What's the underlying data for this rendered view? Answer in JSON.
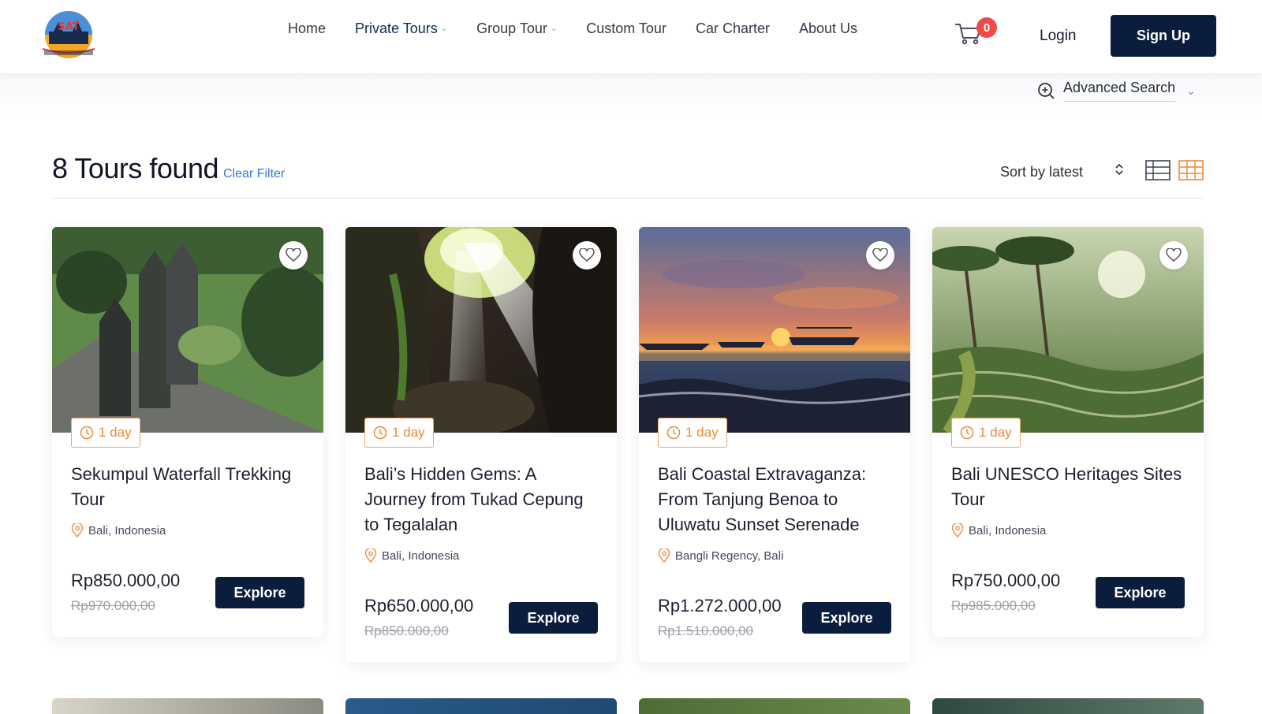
{
  "brand": {
    "logo_name": "site-logo"
  },
  "nav": {
    "items": [
      {
        "label": "Home",
        "dropdown": false
      },
      {
        "label": "Private Tours",
        "dropdown": true,
        "active": true
      },
      {
        "label": "Group Tour",
        "dropdown": true
      },
      {
        "label": "Custom Tour",
        "dropdown": false
      },
      {
        "label": "Car Charter",
        "dropdown": false
      },
      {
        "label": "About Us",
        "dropdown": false
      }
    ],
    "cart_count": "0",
    "login_label": "Login",
    "signup_label": "Sign Up"
  },
  "search": {
    "advanced_label": "Advanced Search"
  },
  "results": {
    "count_label": "8 Tours found",
    "clear_filter_label": "Clear Filter",
    "sort_label": "Sort by latest"
  },
  "tours": [
    {
      "duration": "1 day",
      "title": "Sekumpul Waterfall Trekking Tour",
      "location": "Bali, Indonesia",
      "price": "Rp850.000,00",
      "old_price": "Rp970.000,00",
      "explore_label": "Explore"
    },
    {
      "duration": "1 day",
      "title": "Bali’s Hidden Gems: A Journey from Tukad Cepung to Tegalalan",
      "location": "Bali, Indonesia",
      "price": "Rp650.000,00",
      "old_price": "Rp850.000,00",
      "explore_label": "Explore"
    },
    {
      "duration": "1 day",
      "title": "Bali Coastal Extravaganza: From Tanjung Benoa to Uluwatu Sunset Serenade",
      "location": "Bangli Regency, Bali",
      "price": "Rp1.272.000,00",
      "old_price": "Rp1.510.000,00",
      "explore_label": "Explore"
    },
    {
      "duration": "1 day",
      "title": "Bali UNESCO Heritages Sites Tour",
      "location": "Bali, Indonesia",
      "price": "Rp750.000,00",
      "old_price": "Rp985.000,00",
      "explore_label": "Explore"
    }
  ],
  "colors": {
    "primary": "#0a1d3d",
    "accent_orange": "#ea8a3a",
    "link_blue": "#2f7bd8",
    "badge_red": "#ef4a4a"
  }
}
